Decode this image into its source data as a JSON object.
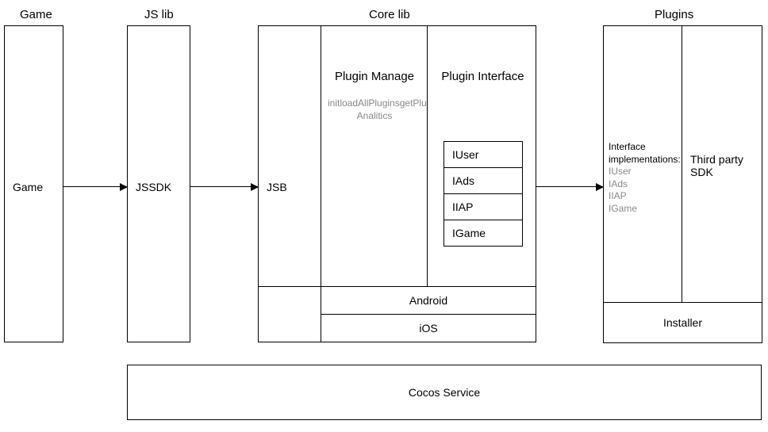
{
  "headers": {
    "game": "Game",
    "jslib": "JS lib",
    "corelib": "Core lib",
    "plugins": "Plugins"
  },
  "boxes": {
    "game": "Game",
    "jssdk": "JSSDK",
    "jsb": "JSB",
    "plugin_manage": "Plugin Manage",
    "plugin_manage_sub": "initloadAllPluginsgetPlugin…Analitics",
    "plugin_interface": "Plugin Interface",
    "android": "Android",
    "ios": "iOS",
    "third_party": "Third party SDK",
    "installer": "Installer",
    "cocos_service": "Cocos Service"
  },
  "interfaces": {
    "iuser": "IUser",
    "iads": "IAds",
    "iiap": "IIAP",
    "igame": "IGame"
  },
  "impl": {
    "title": "Interface implementations:",
    "iuser": "IUser",
    "iads": "IAds",
    "iiap": "IIAP",
    "igame": "IGame"
  }
}
